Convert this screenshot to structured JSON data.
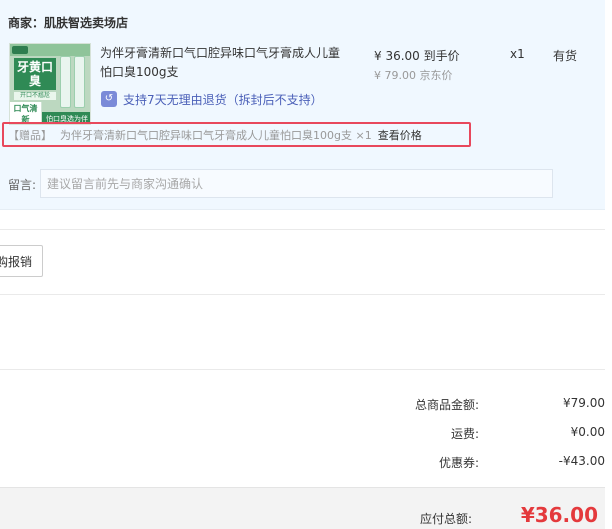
{
  "merchant": {
    "label": "商家：肌肤智选卖场店"
  },
  "product": {
    "title": "为伴牙膏清新口气口腔异味口气牙膏成人儿童怕口臭100g支",
    "price_now": "¥ 36.00 到手价",
    "price_old": "¥ 79.00 京东价",
    "qty": "x1",
    "stock": "有货",
    "return_policy": "支持7天无理由退货（拆封后不支持）",
    "return_icon": "return-7day-icon",
    "thumb_text": {
      "title": "牙黄口臭",
      "sub": "开口不尴尬",
      "badge": "口气清新",
      "tag": "怕口臭选为伴"
    }
  },
  "gift": {
    "label": "【赠品】",
    "name": "为伴牙膏清新口气口腔异味口气牙膏成人儿童怕口臭100g支 ×1",
    "link": "查看价格"
  },
  "message": {
    "label": "留言:",
    "placeholder": "建议留言前先与商家沟通确认"
  },
  "reimburse": {
    "label": "购报销"
  },
  "summary": {
    "goods_label": "总商品金额:",
    "goods_value": "¥79.00",
    "shipping_label": "运费:",
    "shipping_value": "¥0.00",
    "coupon_label": "优惠券:",
    "coupon_value": "-¥43.00"
  },
  "total": {
    "label": "应付总额:",
    "value": "¥36.00"
  },
  "colors": {
    "panel_bg": "#f0f8ff",
    "gift_border": "#e8485c",
    "total_red": "#e4393c",
    "link_blue": "#4a5fb8"
  }
}
